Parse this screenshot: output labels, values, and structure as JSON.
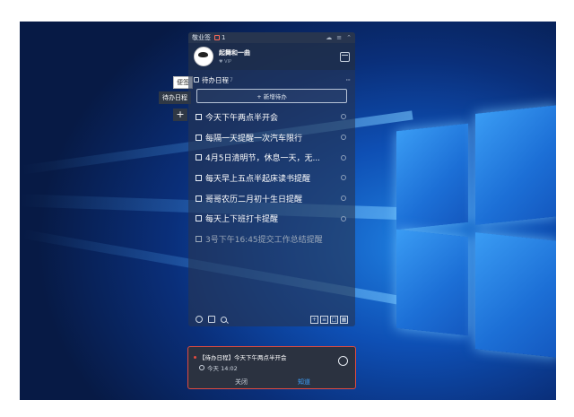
{
  "sidebar_tabs": {
    "top_tab": "便签",
    "todo_tab": "待办日程",
    "plus": "+"
  },
  "app": {
    "title": "敬业签",
    "note_count": "1",
    "titlebar_icons": [
      "cloud-icon",
      "menu-icon",
      "collapse-icon"
    ]
  },
  "profile": {
    "name": "起舞和一曲",
    "sub": "♥ VIP"
  },
  "section": {
    "label": "待办日程",
    "count": "7",
    "more": "···"
  },
  "add_button": "+ 新增待办",
  "tasks": [
    {
      "text": "今天下午两点半开会",
      "done": false
    },
    {
      "text": "每隔一天提醒一次汽车限行",
      "done": false
    },
    {
      "text": "4月5日清明节，休息一天，无...",
      "done": false
    },
    {
      "text": "每天早上五点半起床读书提醒",
      "done": false
    },
    {
      "text": "哥哥农历二月初十生日提醒",
      "done": false
    },
    {
      "text": "每天上下班打卡提醒",
      "done": false
    },
    {
      "text": "3号下午16:45提交工作总结提醒",
      "done": true
    }
  ],
  "bottom_icons": [
    "clock-icon",
    "calendar-icon",
    "search-icon"
  ],
  "notification": {
    "title": "【待办日程】今天下午两点半开会",
    "time": "今天 14:02",
    "close": "关闭",
    "now": "知道"
  },
  "colors": {
    "accent_red": "#e24b3f",
    "link_blue": "#3da2ff",
    "panel_bg": "#263652"
  }
}
